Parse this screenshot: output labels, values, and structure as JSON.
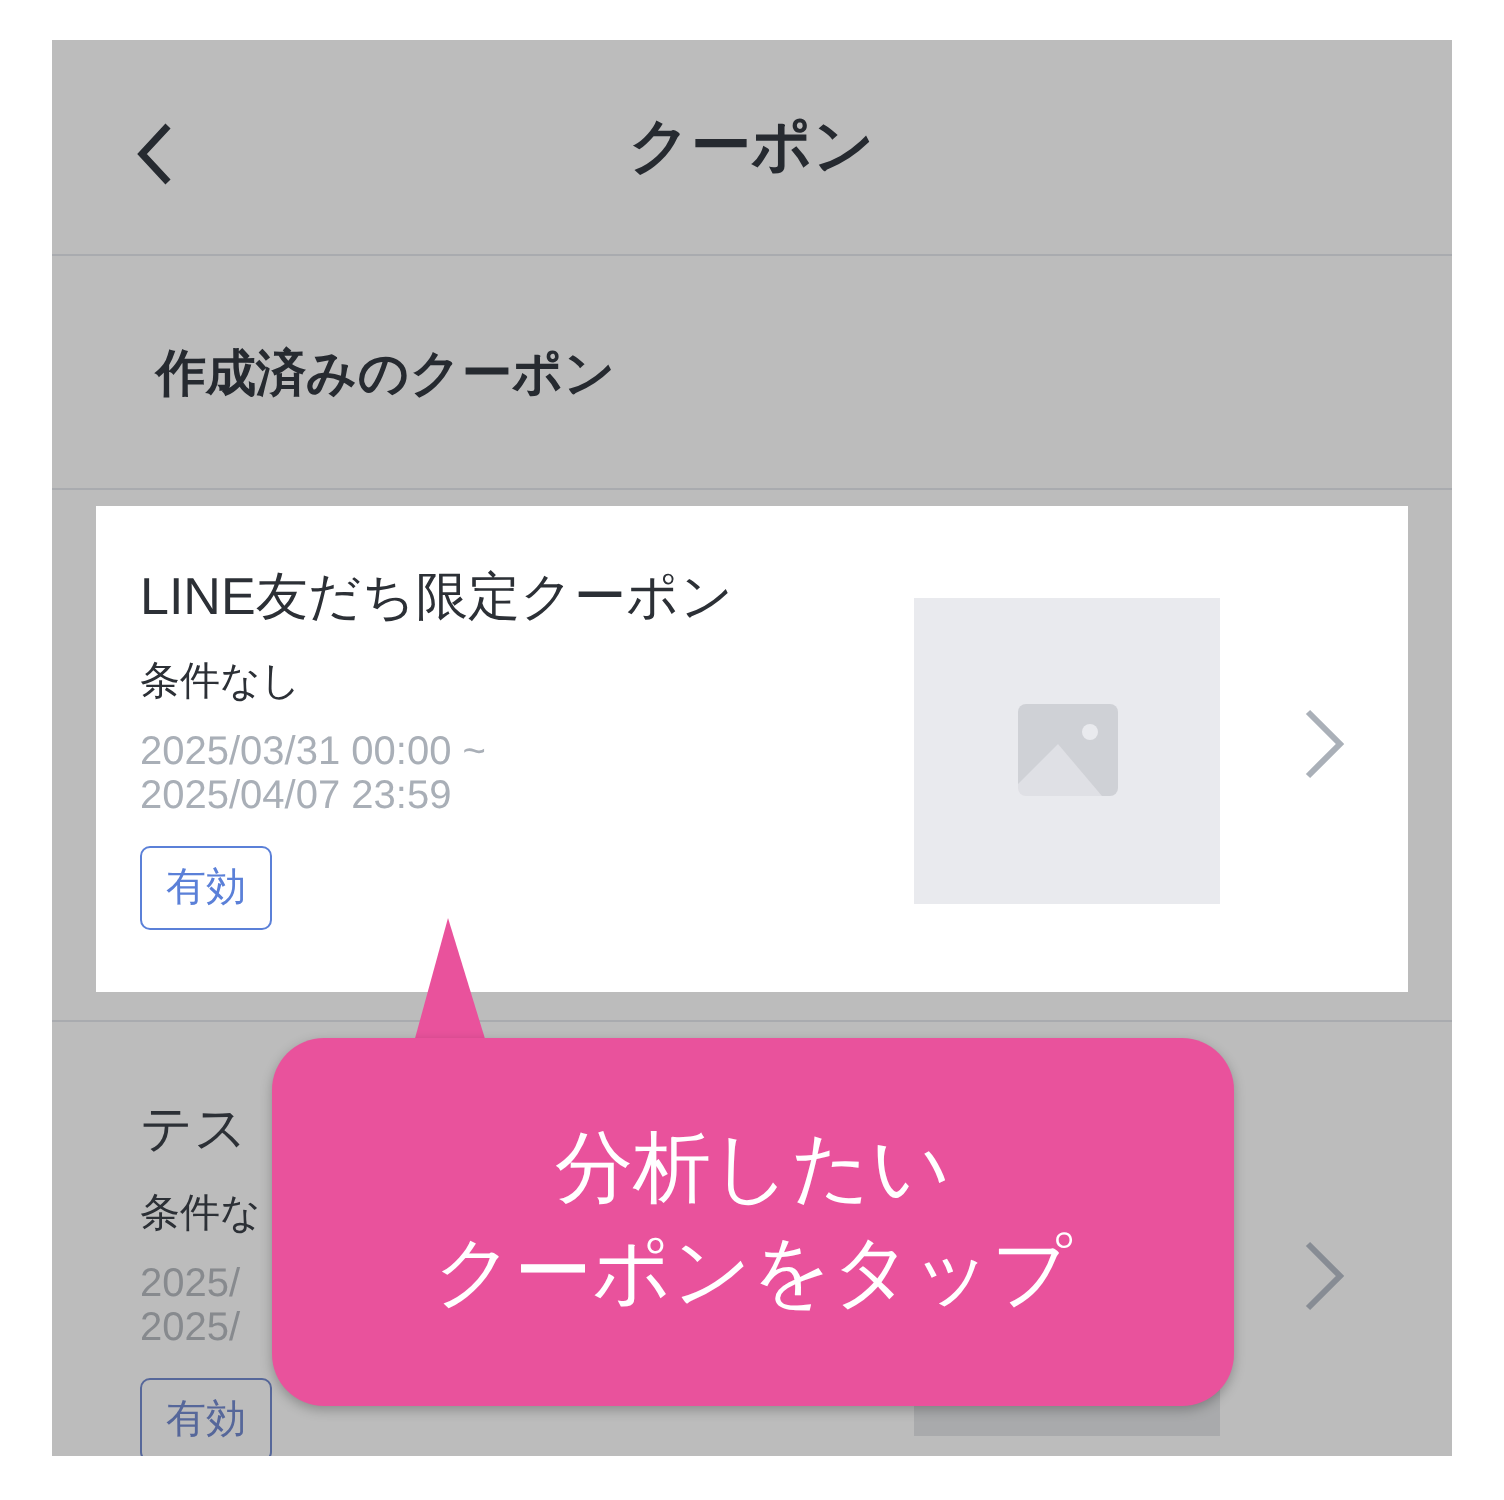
{
  "header": {
    "title": "クーポン"
  },
  "section": {
    "title": "作成済みのクーポン"
  },
  "coupons": [
    {
      "title": "LINE友だち限定クーポン",
      "condition": "条件なし",
      "period": [
        "2025/03/31 00:00 ~",
        "2025/04/07 23:59"
      ],
      "status": "有効",
      "highlighted": true
    },
    {
      "title": "テス",
      "condition": "条件な",
      "period": [
        "2025/",
        "2025/"
      ],
      "status": "有効",
      "highlighted": false
    }
  ],
  "callout": {
    "lines": [
      "分析したい",
      "クーポンをタップ"
    ]
  }
}
